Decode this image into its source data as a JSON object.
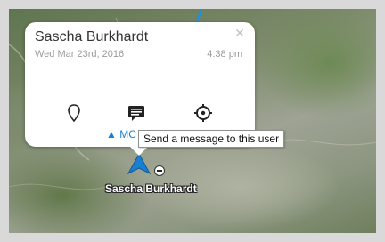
{
  "popup": {
    "user_name": "Sascha Burkhardt",
    "date": "Wed Mar 23rd, 2016",
    "time": "4:38 pm",
    "close_glyph": "✕",
    "more_label": "▲ MC",
    "actions": [
      {
        "icon": "location-pin-icon"
      },
      {
        "icon": "message-icon"
      },
      {
        "icon": "crosshair-icon"
      }
    ]
  },
  "tooltip": {
    "text": "Send a message to this user"
  },
  "map": {
    "marker_label": "Sascha Burkhardt",
    "track_color": "#1f8fe0",
    "marker_color": "#1a7fd0"
  }
}
